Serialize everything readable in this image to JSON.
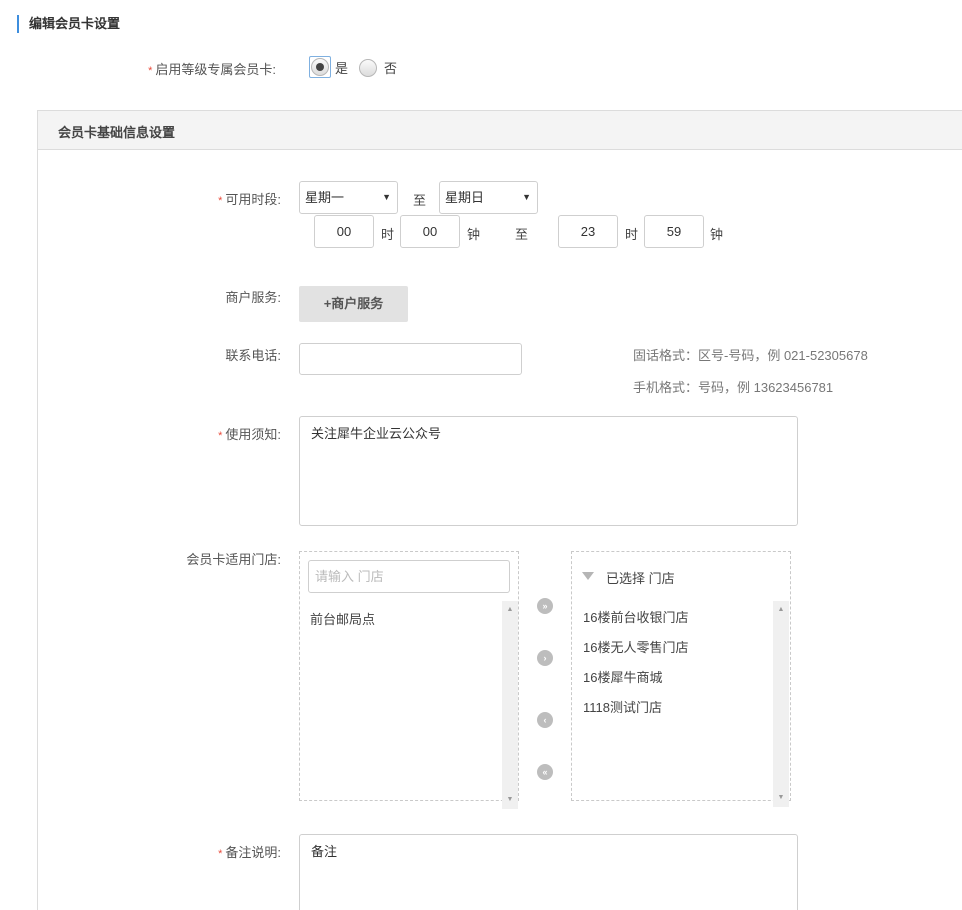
{
  "header": {
    "title": "编辑会员卡设置"
  },
  "level_card": {
    "label": "启用等级专属会员卡:",
    "options": [
      {
        "label": "是",
        "selected": true
      },
      {
        "label": "否",
        "selected": false
      }
    ]
  },
  "panel": {
    "title": "会员卡基础信息设置"
  },
  "available_time": {
    "label": "可用时段:",
    "start_day": "星期一",
    "to_label": "至",
    "end_day": "星期日",
    "start_hour": "00",
    "start_minute": "00",
    "end_hour": "23",
    "end_minute": "59",
    "hour_unit": "时",
    "minute_unit": "钟"
  },
  "merchant_service": {
    "label": "商户服务:",
    "button": "+商户服务"
  },
  "contact_phone": {
    "label": "联系电话:",
    "value": "",
    "hint_landline": "固话格式：区号-号码，例 021-52305678",
    "hint_mobile": "手机格式：号码，例 13623456781"
  },
  "usage_notes": {
    "label": "使用须知:",
    "value": "关注犀牛企业云公众号"
  },
  "stores": {
    "label": "会员卡适用门店:",
    "search_placeholder": "请输入 门店",
    "available": [
      "前台邮局点"
    ],
    "selected_title": "已选择 门店",
    "selected": [
      "16楼前台收银门店",
      "16楼无人零售门店",
      "16楼犀牛商城",
      "1118测试门店"
    ]
  },
  "remarks": {
    "label": "备注说明:",
    "value": "备注"
  },
  "colors": {
    "required": "#e94b3b",
    "accent": "#3e8ede",
    "button_gray": "#e2e2e2"
  }
}
